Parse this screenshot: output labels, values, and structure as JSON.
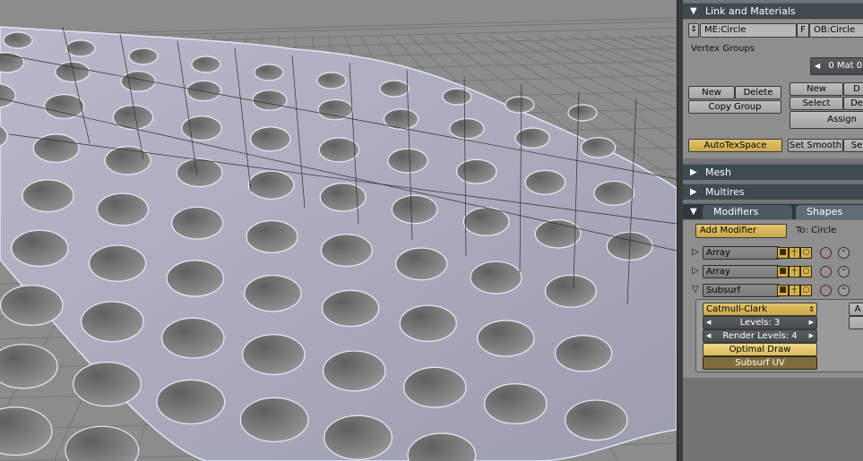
{
  "panels": {
    "link_materials": {
      "header": "Link and Materials",
      "mesh_field": "ME:Circle",
      "f_button": "F",
      "ob_field": "OB:Circle",
      "vertex_groups_label": "Vertex Groups",
      "mat_field": "0 Mat 0",
      "new_label": "New",
      "delete_label": "Delete",
      "copy_group_label": "Copy Group",
      "new2_label": "New",
      "d_label": "D",
      "select_label": "Select",
      "de_label": "De",
      "assign_label": "Assign",
      "autotexspace_label": "AutoTexSpace",
      "set_smooth_label": "Set Smooth",
      "se_label": "Se"
    },
    "mesh": {
      "header": "Mesh"
    },
    "multires": {
      "header": "Multires"
    },
    "modifiers": {
      "tab_modifiers": "Modifiers",
      "tab_shapes": "Shapes",
      "add_modifier_label": "Add Modifier",
      "to_label": "To: Circle",
      "stack": [
        {
          "name": "Array"
        },
        {
          "name": "Array"
        },
        {
          "name": "Subsurf"
        }
      ],
      "subsurf": {
        "type": "Catmull-Clark",
        "levels": "Levels: 3",
        "render_levels": "Render Levels: 4",
        "optimal_draw": "Optimal Draw",
        "subsurf_uv": "Subsurf UV",
        "a_label": "A"
      }
    }
  },
  "colors": {
    "header": "#3e4950",
    "panel_bg": "#8e8e8e",
    "accent_yellow": "#d8b85a",
    "viewport_bg": "#8c8c8c",
    "mesh_color": "#b3b3c4"
  },
  "icons": {
    "expand": "triangle-right-icon",
    "collapse": "triangle-down-icon"
  }
}
